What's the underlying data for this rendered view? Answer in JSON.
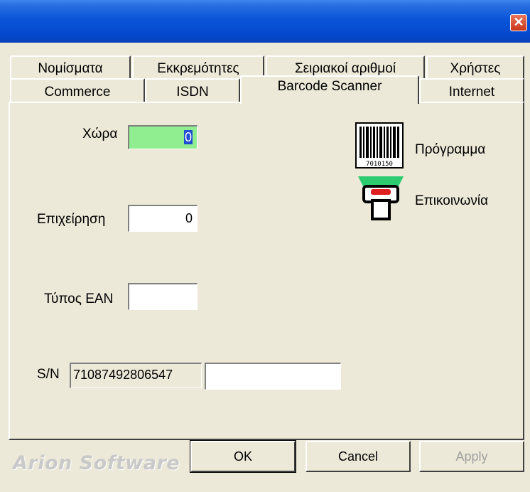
{
  "window": {
    "close_glyph": "✕"
  },
  "tabs_back_row": [
    {
      "label": "Νομίσματα"
    },
    {
      "label": "Εκκρεμότητες"
    },
    {
      "label": "Σειριακοί αριθμοί"
    },
    {
      "label": "Χρήστες"
    }
  ],
  "tabs_front_row": [
    {
      "label": "Commerce"
    },
    {
      "label": "ISDN"
    },
    {
      "label": "Barcode Scanner",
      "active": true
    },
    {
      "label": "Internet"
    }
  ],
  "form": {
    "country_label": "Χώρα",
    "country_value": "0",
    "company_label": "Επιχείρηση",
    "company_value": "0",
    "ean_type_label": "Τύπος ΕΑΝ",
    "ean_type_value": "",
    "serial_label": "S/N",
    "serial_value": "71087492806547",
    "serial_extra_value": ""
  },
  "side_actions": {
    "program_label": "Πρόγραμμα",
    "barcode_digits": "7010150",
    "communication_label": "Επικοινωνία"
  },
  "footer": {
    "brand": "Arion Software",
    "ok_label": "OK",
    "cancel_label": "Cancel",
    "apply_label": "Apply"
  },
  "colors": {
    "titlebar": "#0a55d8",
    "field_highlight": "#90ee90",
    "selection": "#1f4ed1",
    "scanner_head": "#2ecc71",
    "scanner_light": "#e02020"
  }
}
